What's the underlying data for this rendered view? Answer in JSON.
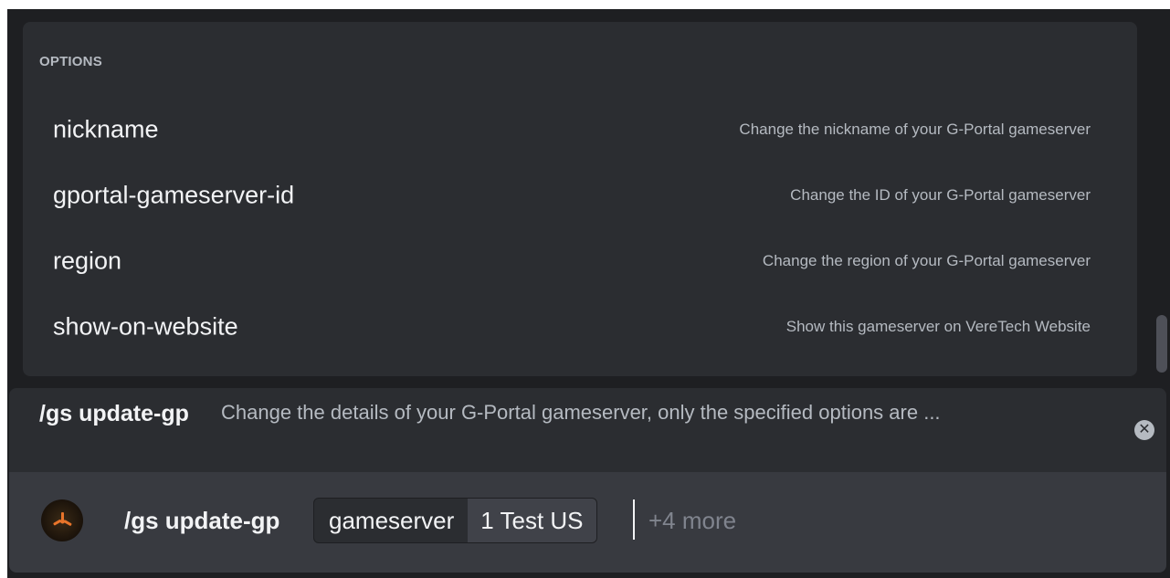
{
  "options_panel": {
    "header": "OPTIONS",
    "items": [
      {
        "name": "nickname",
        "description": "Change the nickname of your G-Portal gameserver"
      },
      {
        "name": "gportal-gameserver-id",
        "description": "Change the ID of your G-Portal gameserver"
      },
      {
        "name": "region",
        "description": "Change the region of your G-Portal gameserver"
      },
      {
        "name": "show-on-website",
        "description": "Show this gameserver on VereTech Website"
      }
    ]
  },
  "command_header": {
    "name": "/gs update-gp",
    "description": "Change the details of your G-Portal gameserver, only the specified options are ...",
    "close_icon": "close-circle-icon"
  },
  "input_bar": {
    "avatar_icon": "bot-avatar-icon",
    "command": "/gs update-gp",
    "option_name": "gameserver",
    "option_value": "1 Test US",
    "more_options": "+4 more"
  },
  "colors": {
    "background": "#1e1f22",
    "panel": "#2b2d31",
    "input": "#383a40",
    "text_primary": "#f2f3f5",
    "text_muted": "#b5bac1"
  }
}
